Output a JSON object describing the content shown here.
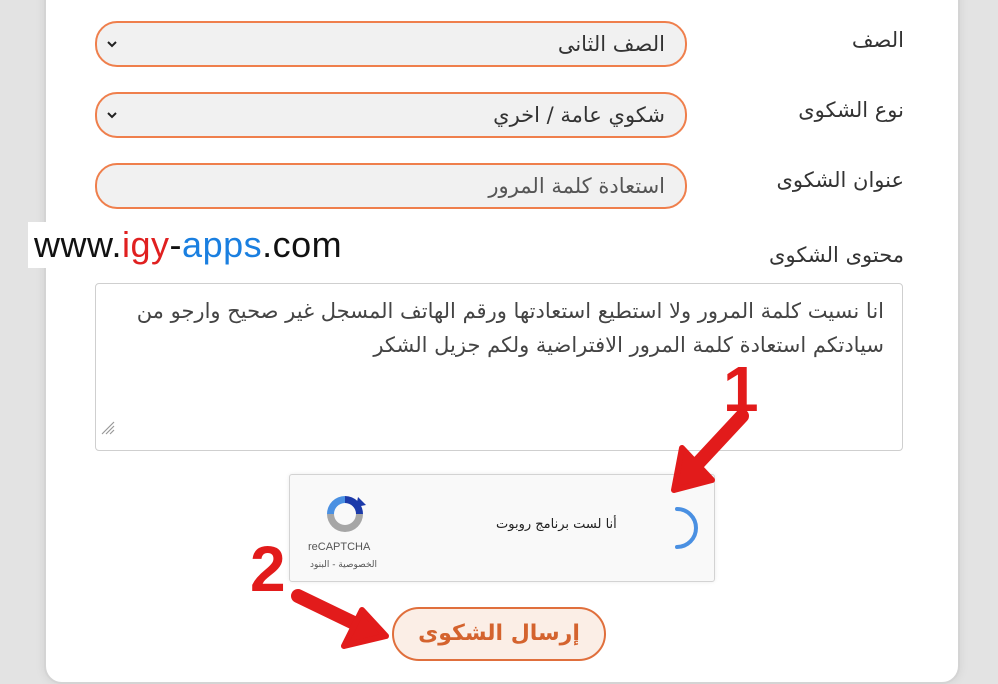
{
  "form": {
    "grade": {
      "label": "الصف",
      "value": "الصف الثانى"
    },
    "complaint_type": {
      "label": "نوع الشكوى",
      "value": "شكوي عامة / اخري"
    },
    "complaint_title": {
      "label": "عنوان الشكوى",
      "value": "استعادة كلمة المرور"
    },
    "complaint_content": {
      "label": "محتوى الشكوى",
      "value": "انا نسيت كلمة المرور ولا استطيع استعادتها ورقم الهاتف المسجل غير صحيح وارجو من سيادتكم استعادة كلمة المرور الافتراضية ولكم جزيل الشكر"
    },
    "submit_label": "إرسال الشكوى"
  },
  "recaptcha": {
    "checkbox_text": "أنا لست برنامج روبوت",
    "brand": "reCAPTCHA",
    "links": "الخصوصية - البنود"
  },
  "watermark": {
    "part1": "www.",
    "part2": "igy",
    "part3": "-",
    "part4": "apps",
    "part5": ".com"
  },
  "annotations": {
    "step1": "1",
    "step2": "2"
  },
  "colors": {
    "accent": "#ef7f4c",
    "submit_text": "#d4632e",
    "arrow_red": "#e21b1b",
    "watermark_red": "#e02020",
    "watermark_blue": "#1a7fe0"
  }
}
